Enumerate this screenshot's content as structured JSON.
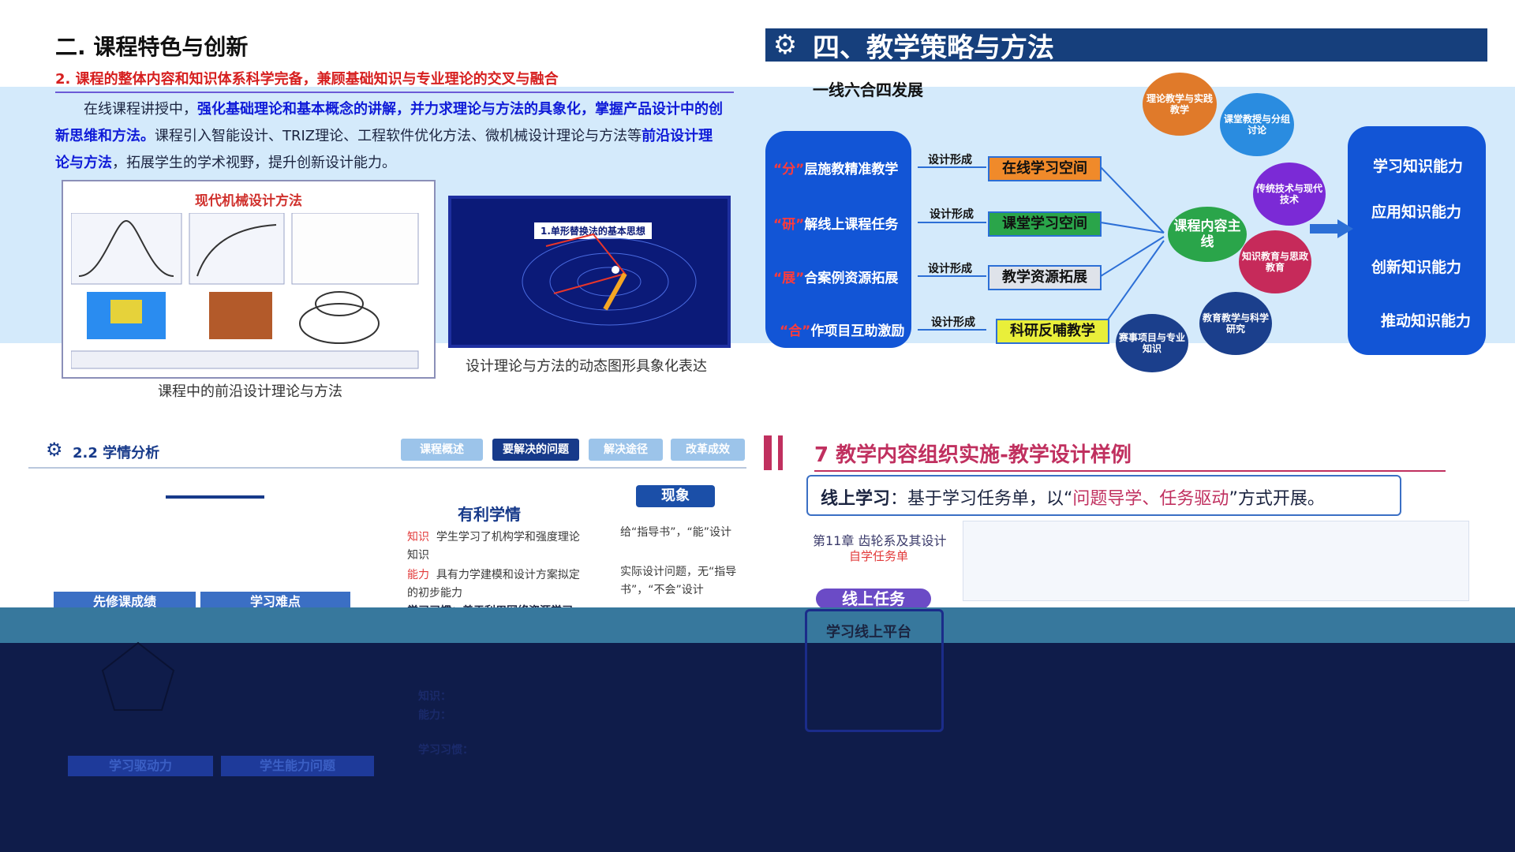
{
  "panel1": {
    "title": "二. 课程特色与创新",
    "subtitle": "2. 课程的整体内容和知识体系科学完备，兼顾基础知识与专业理论的交叉与融合",
    "para_prefix": "在线课程讲授中，",
    "para_em1": "强化基础理论和基本概念的讲解，并力求理论与方法的具象化，掌握产品设计中的创新思维和方法。",
    "para_mid": "课程引入智能设计、TRIZ理论、工程软件优化方法、微机械设计理论与方法等",
    "para_em2": "前沿设计理论与方法",
    "para_suffix": "，拓展学生的学术视野，提升创新设计能力。",
    "fig_left_title": "现代机械设计方法",
    "fig_left_caption": "课程中的前沿设计理论与方法",
    "fig_right_tag": "1.单形替换法的基本思想",
    "fig_right_caption": "设计理论与方法的动态图形具象化表达"
  },
  "panel2": {
    "title": "四、教学策略与方法",
    "subtitle": "一线六合四发展",
    "rows": [
      {
        "quote": "“分”",
        "label": "层施教精准教学",
        "form": "设计形成",
        "space": "在线学习空间",
        "style": "box-orange"
      },
      {
        "quote": "“研”",
        "label": "解线上课程任务",
        "form": "设计形成",
        "space": "课堂学习空间",
        "style": "box-green"
      },
      {
        "quote": "“展”",
        "label": "合案例资源拓展",
        "form": "设计形成",
        "space": "教学资源拓展",
        "style": "box-gray"
      },
      {
        "quote": "“合”",
        "label": "作项目互助激励",
        "form": "设计形成",
        "space": "科研反哺教学",
        "style": "box-yellow"
      }
    ],
    "center_circle": "课程内容主线",
    "circles": [
      "理论教学与实践教学",
      "课堂教授与分组讨论",
      "传统技术与现代技术",
      "知识教育与思政教育",
      "教育教学与科学研究",
      "赛事项目与专业知识"
    ],
    "abilities": [
      "学习知识能力",
      "应用知识能力",
      "创新知识能力",
      "推动知识能力"
    ],
    "colors": {
      "bar": "#163f7c",
      "pill": "#1255d6"
    }
  },
  "panel3": {
    "title": "2.2 学情分析",
    "tabs": [
      "课程概述",
      "要解决的问题",
      "解决途径",
      "改革成效"
    ],
    "active_tab": "要解决的问题",
    "favorable_title": "有利学情",
    "knowledge_label": "知识",
    "knowledge_text": "学生学习了机构学和强度理论知识",
    "ability_label": "能力",
    "ability_text": "具有力学建模和设计方案拟定的初步能力",
    "habit_text": "学习习惯：善于利用网络资源学习",
    "phenomenon_title": "现象",
    "phenomenon_items": [
      "给“指导书”，“能”设计",
      "实际设计问题，无“指导书”，“不会”设计"
    ],
    "prereq_labels": [
      "先修课成绩",
      "学习难点"
    ],
    "bottom_labels": [
      "学习驱动力",
      "学生能力问题"
    ],
    "bottom_left_items": [
      "知识：",
      "能力：",
      "学习习惯："
    ]
  },
  "panel4": {
    "title": "7 教学内容组织实施-教学设计样例",
    "box_strong": "线上学习",
    "box_text_a": "：基于学习任务单，以“",
    "box_red": "问题导学、任务驱动",
    "box_text_b": "”方式开展。",
    "chapter": "第11章 齿轮系及其设计",
    "chapter_sub": "自学任务单",
    "task_label": "线上任务",
    "platform_label": "学习线上平台"
  }
}
